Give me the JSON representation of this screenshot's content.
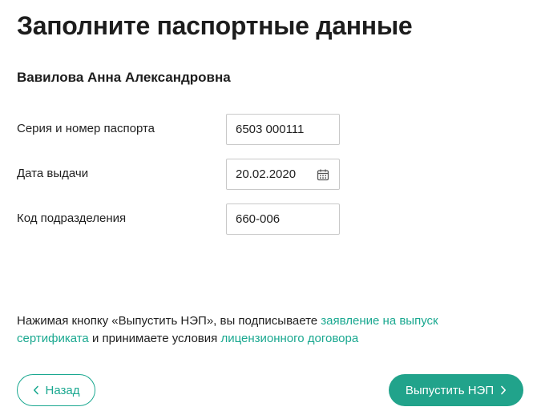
{
  "page": {
    "title": "Заполните паспортные данные",
    "full_name": "Вавилова Анна Александровна"
  },
  "form": {
    "passport": {
      "label": "Серия и номер паспорта",
      "value": "6503 000111"
    },
    "issue_date": {
      "label": "Дата выдачи",
      "value": "20.02.2020",
      "icon": "calendar-icon"
    },
    "division_code": {
      "label": "Код подразделения",
      "value": "660-006"
    }
  },
  "consent": {
    "text_before": "Нажимая кнопку «Выпустить НЭП», вы подписываете ",
    "link_application": "заявление на выпуск сертификата",
    "text_middle": " и принимаете условия ",
    "link_license": "лицензионного договора"
  },
  "actions": {
    "back_label": "Назад",
    "issue_label": "Выпустить НЭП"
  },
  "colors": {
    "accent": "#1aa890",
    "primary_button": "#21a38b"
  }
}
